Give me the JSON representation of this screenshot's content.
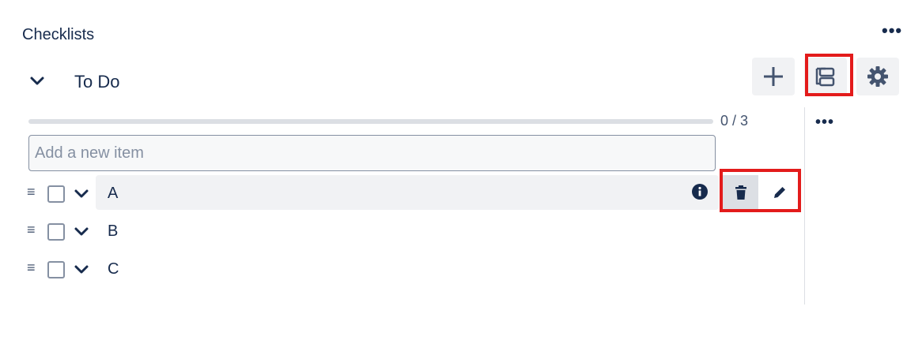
{
  "header": {
    "title": "Checklists"
  },
  "checklist": {
    "name": "To Do",
    "progress_text": "0 / 3",
    "progress_fraction": 0,
    "new_item_placeholder": "Add a new item",
    "items": [
      {
        "label": "A",
        "checked": false
      },
      {
        "label": "B",
        "checked": false
      },
      {
        "label": "C",
        "checked": false
      }
    ]
  },
  "icons": {
    "header_more": "more-horizontal-icon",
    "collapse": "chevron-down-icon",
    "add": "plus-icon",
    "board": "board-view-icon",
    "settings": "gear-icon",
    "drag": "drag-handle-icon",
    "info": "info-icon",
    "delete": "trash-icon",
    "edit": "pencil-icon"
  },
  "colors": {
    "highlight": "#e31b1b",
    "text": "#172b4d",
    "button_bg": "#f1f2f4"
  }
}
